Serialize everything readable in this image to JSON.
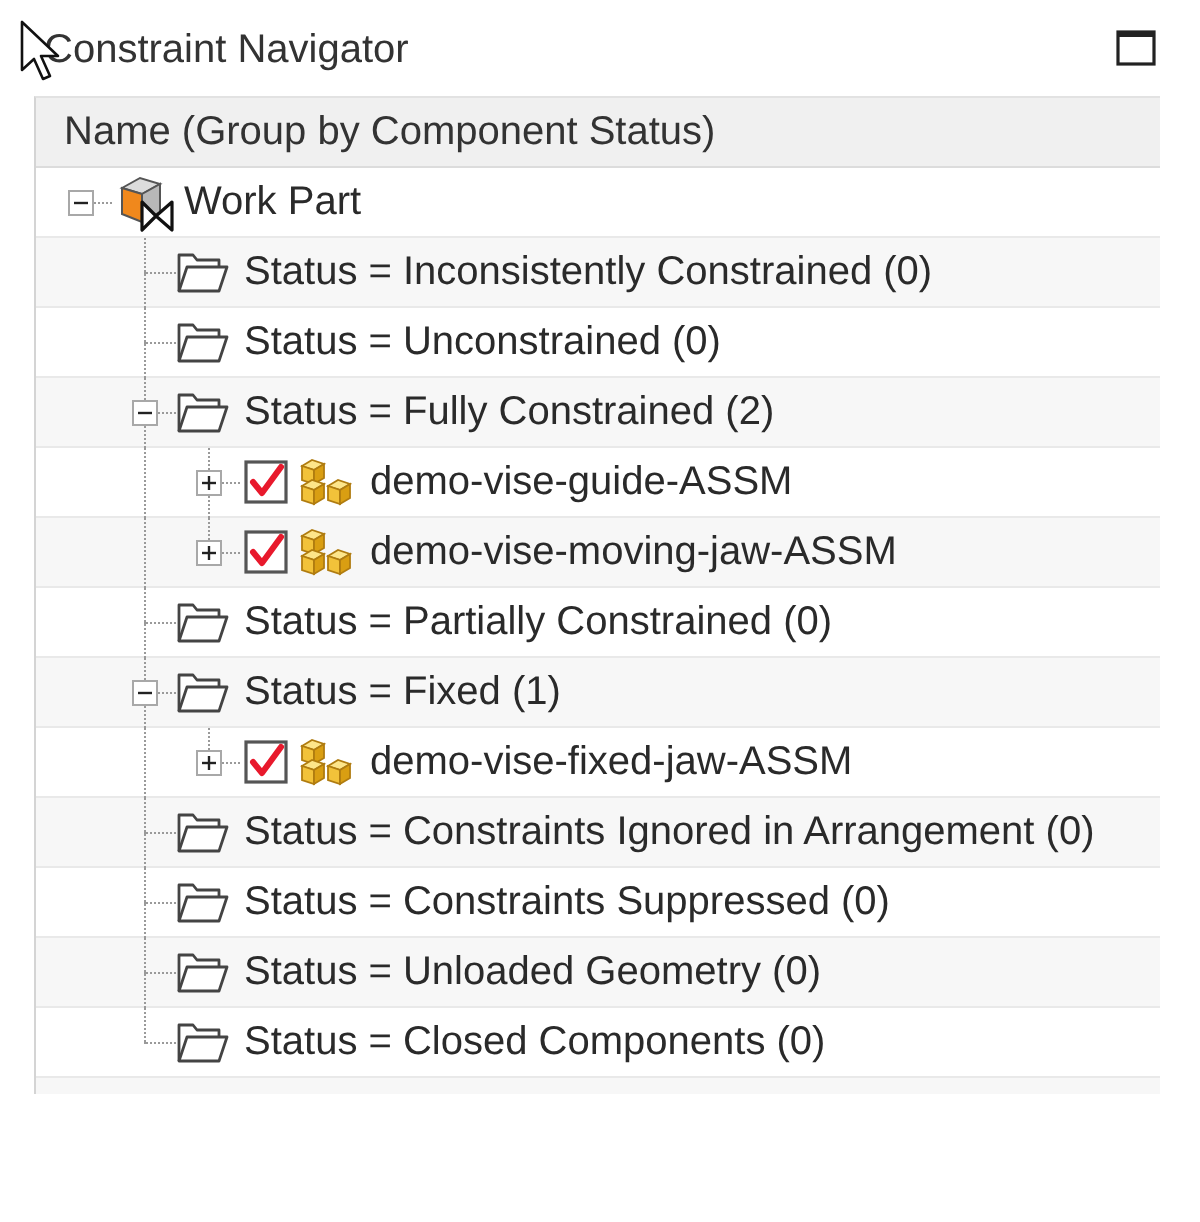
{
  "window": {
    "title": "Constraint Navigator"
  },
  "tree": {
    "column_header": "Name (Group by Component Status)",
    "items": [
      {
        "label": "Work Part",
        "kind": "part",
        "expanded": true,
        "children": [
          {
            "label": "Status = Inconsistently Constrained (0)",
            "kind": "group"
          },
          {
            "label": "Status = Unconstrained (0)",
            "kind": "group"
          },
          {
            "label": "Status = Fully Constrained (2)",
            "kind": "group",
            "expanded": true,
            "children": [
              {
                "label": "demo-vise-guide-ASSM",
                "kind": "component",
                "checked": true,
                "expanded": false
              },
              {
                "label": "demo-vise-moving-jaw-ASSM",
                "kind": "component",
                "checked": true,
                "expanded": false
              }
            ]
          },
          {
            "label": "Status = Partially Constrained (0)",
            "kind": "group"
          },
          {
            "label": "Status = Fixed (1)",
            "kind": "group",
            "expanded": true,
            "children": [
              {
                "label": "demo-vise-fixed-jaw-ASSM",
                "kind": "component",
                "checked": true,
                "expanded": false
              }
            ]
          },
          {
            "label": "Status = Constraints Ignored in Arrangement (0)",
            "kind": "group"
          },
          {
            "label": "Status = Constraints Suppressed (0)",
            "kind": "group"
          },
          {
            "label": "Status = Unloaded Geometry (0)",
            "kind": "group"
          },
          {
            "label": "Status = Closed Components (0)",
            "kind": "group"
          }
        ]
      }
    ]
  }
}
